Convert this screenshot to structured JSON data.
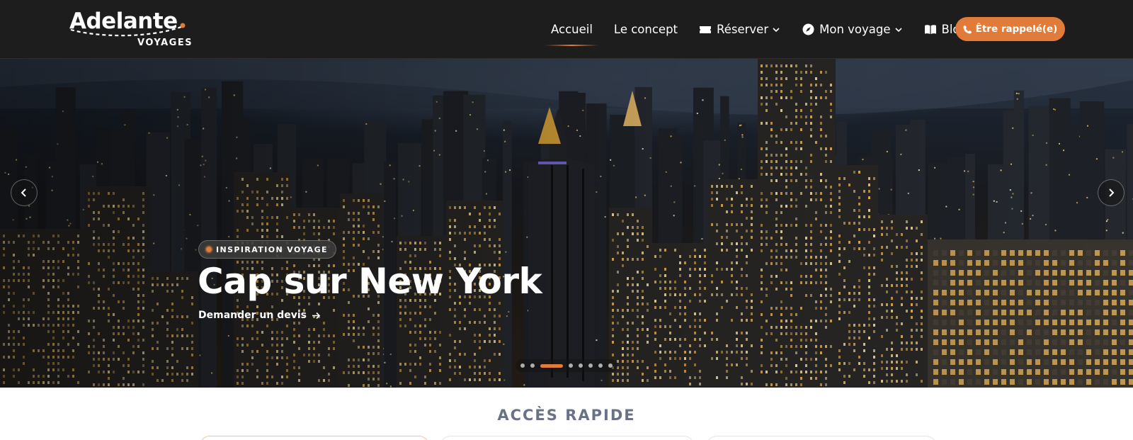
{
  "brand": {
    "logo_text": "Adelante",
    "logo_sub": "VOYAGES"
  },
  "nav": {
    "items": [
      {
        "label": "Accueil",
        "icon": "none",
        "active": true
      },
      {
        "label": "Le concept",
        "icon": "none"
      },
      {
        "label": "Réserver",
        "icon": "ticket-icon",
        "dropdown": true
      },
      {
        "label": "Mon voyage",
        "icon": "compass-icon",
        "dropdown": true
      },
      {
        "label": "Blog",
        "icon": "book-icon"
      }
    ],
    "cta_label": "Être rappelé(e)",
    "cta_icon": "phone-icon"
  },
  "hero": {
    "badge": "INSPIRATION VOYAGE",
    "title": "Cap sur New York",
    "link_label": "Demander un devis",
    "slides_count": 8,
    "active_slide": 3
  },
  "quick_access": {
    "title": "ACCÈS RAPIDE"
  },
  "colors": {
    "accent": "#e07b39",
    "header_bg": "#1d1d1d",
    "heading": "#6a7288"
  }
}
